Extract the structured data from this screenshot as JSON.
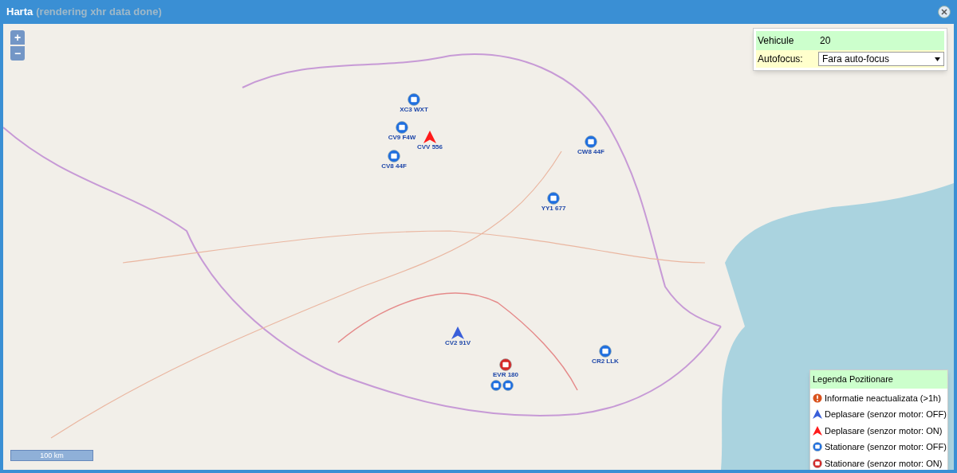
{
  "window": {
    "title": "Harta",
    "status": "(rendering xhr data done)"
  },
  "map_controls": {
    "zoom_in": "+",
    "zoom_out": "−",
    "scale": "100 km"
  },
  "vehicles_panel": {
    "vehicles_label": "Vehicule",
    "vehicles_value": "20",
    "autofocus_label": "Autofocus:",
    "autofocus_value": "Fara auto-focus"
  },
  "markers": [
    {
      "label": "XC3 WXT",
      "kind": "stationary_off"
    },
    {
      "label": "CV9 F4W",
      "kind": "stationary_off"
    },
    {
      "label": "CVV 556",
      "kind": "moving_on"
    },
    {
      "label": "CV8 44F",
      "kind": "stationary_off"
    },
    {
      "label": "CW8 44F",
      "kind": "stationary_off"
    },
    {
      "label": "YY1 677",
      "kind": "stationary_off"
    },
    {
      "label": "CV2 91V",
      "kind": "moving_off"
    },
    {
      "label": "CR2 LLK",
      "kind": "stationary_off"
    },
    {
      "label": "EVR 180",
      "kind": "stationary_on"
    }
  ],
  "legend": {
    "title": "Legenda Pozitionare",
    "items": [
      {
        "label": "Informatie neactualizata (>1h)",
        "kind": "outdated"
      },
      {
        "label": "Deplasare (senzor motor: OFF)",
        "kind": "moving_off"
      },
      {
        "label": "Deplasare (senzor motor: ON)",
        "kind": "moving_on"
      },
      {
        "label": "Stationare (senzor motor: OFF)",
        "kind": "stationary_off"
      },
      {
        "label": "Stationare (senzor motor: ON)",
        "kind": "stationary_on"
      }
    ]
  }
}
